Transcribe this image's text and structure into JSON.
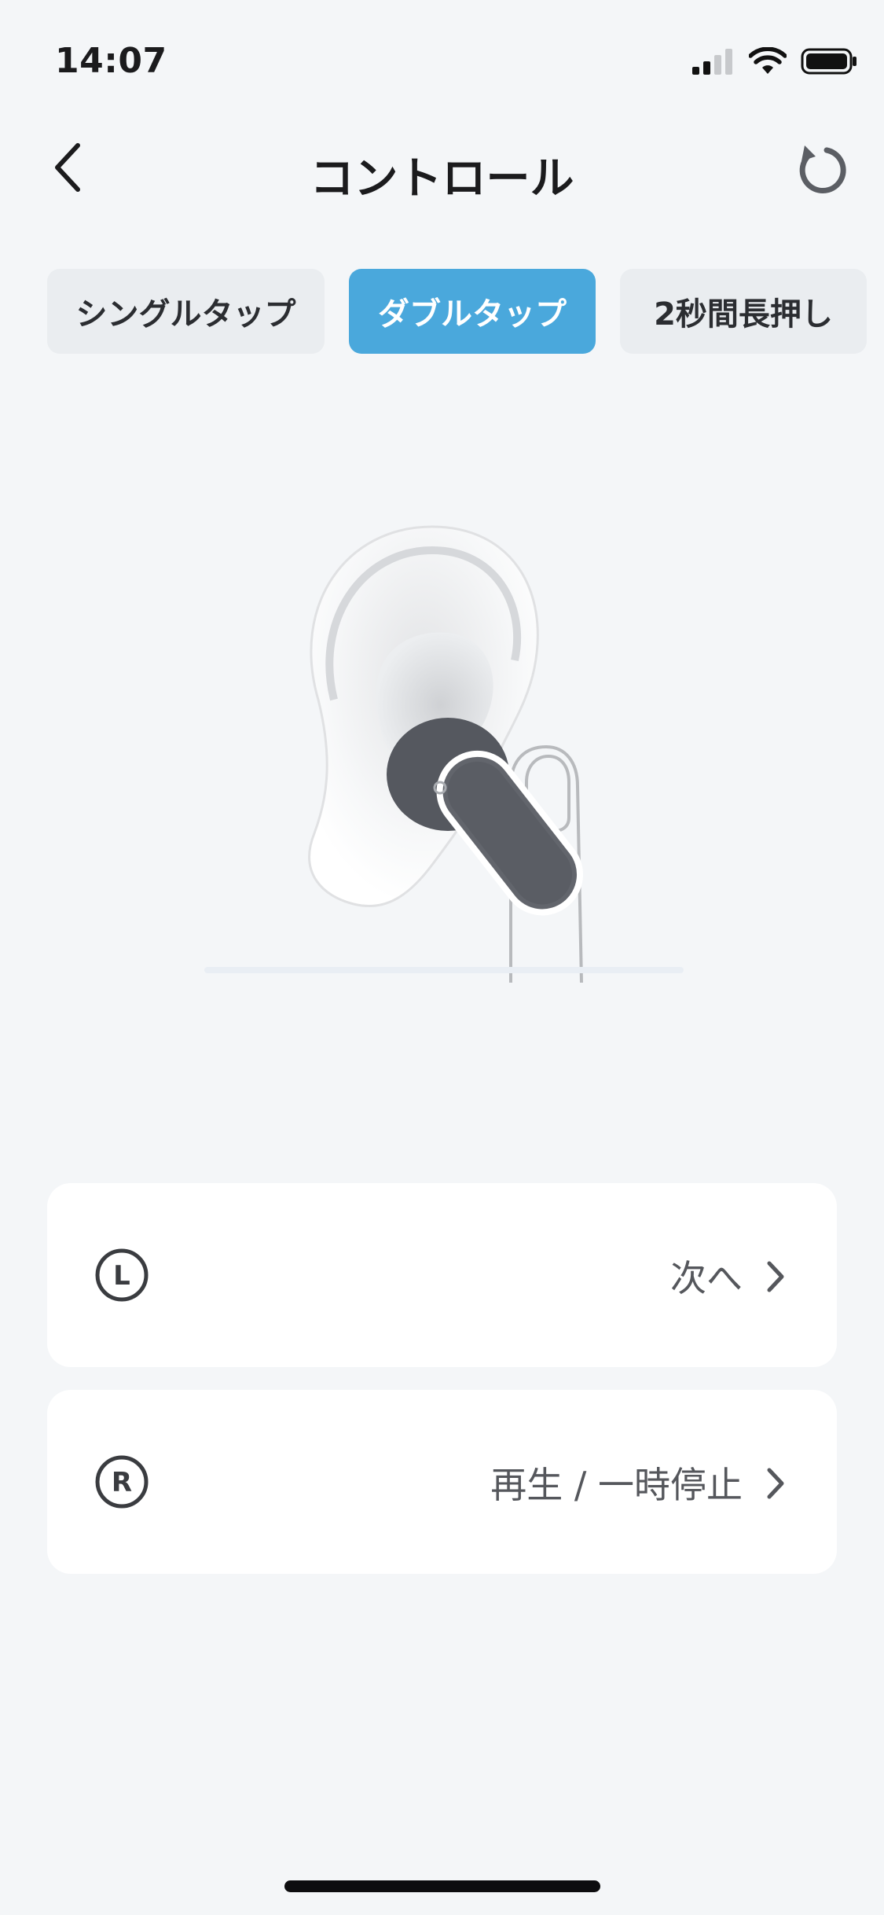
{
  "status_bar": {
    "time": "14:07"
  },
  "header": {
    "title": "コントロール",
    "back_icon": "chevron-left-icon",
    "reset_icon": "reset-icon"
  },
  "tabs": [
    {
      "label": "シングルタップ",
      "active": false
    },
    {
      "label": "ダブルタップ",
      "active": true
    },
    {
      "label": "2秒間長押し",
      "active": false
    }
  ],
  "controls": {
    "left": {
      "side_label": "L",
      "value": "次へ"
    },
    "right": {
      "side_label": "R",
      "value": "再生 / 一時停止"
    }
  },
  "colors": {
    "accent": "#4aa8dc",
    "background": "#f4f6f8",
    "card": "#ffffff"
  }
}
